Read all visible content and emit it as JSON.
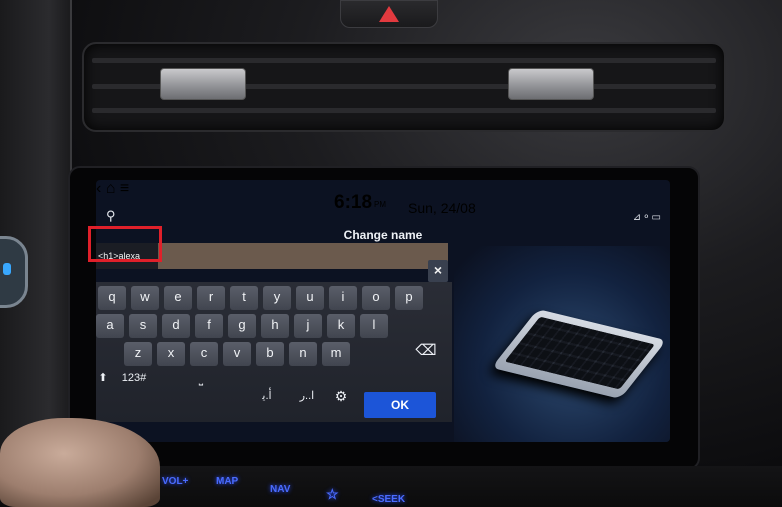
{
  "screen": {
    "time": "6:18",
    "ampm": "PM",
    "date": "Sun, 24/08",
    "title": "Change name",
    "input_value": "<h1>alexa",
    "clear_icon": "×",
    "back_icon": "‹",
    "home_icon": "⌂",
    "menu_icon": "≡",
    "search_icon": "⚲",
    "status_icons": "⊿⚬▭"
  },
  "keyboard": {
    "row1": [
      "q",
      "w",
      "e",
      "r",
      "t",
      "y",
      "u",
      "i",
      "o",
      "p"
    ],
    "row2": [
      "a",
      "s",
      "d",
      "f",
      "g",
      "h",
      "j",
      "k",
      "l"
    ],
    "row3": [
      "z",
      "x",
      "c",
      "v",
      "b",
      "n",
      "m"
    ],
    "shift_label": "⬆",
    "numbers_label": "123#",
    "space_label": "⎵",
    "lang1_label": "ﺃ.ﻳ",
    "lang2_label": "ﺍ..ﺭ",
    "settings_icon": "⚙",
    "backspace_icon": "⌫",
    "ok_label": "OK"
  },
  "hardware": {
    "vol_label": "VOL+",
    "map_label": "MAP",
    "nav_label": "NAV",
    "fav_icon": "☆",
    "seek_label": "<SEEK"
  },
  "colors": {
    "accent": "#1c55d8",
    "highlight": "#e0202a"
  }
}
